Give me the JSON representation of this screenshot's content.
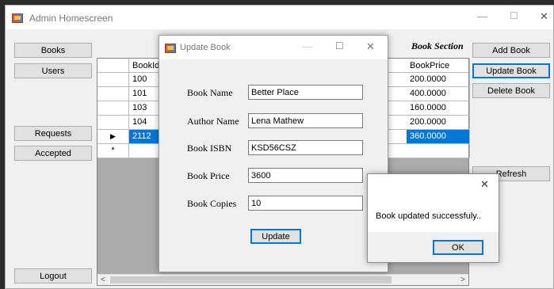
{
  "window": {
    "title": "Admin Homescreen"
  },
  "nav": {
    "books": "Books",
    "users": "Users",
    "requests": "Requests",
    "accepted": "Accepted",
    "logout": "Logout"
  },
  "actions": {
    "section_title": "Book Section",
    "add_book": "Add Book",
    "update_book": "Update Book",
    "delete_book": "Delete Book",
    "refresh": "Refresh"
  },
  "grid": {
    "columns": [
      "BookId",
      "BookPrice"
    ],
    "rows": [
      {
        "id": "100",
        "price": "200.0000"
      },
      {
        "id": "101",
        "price": "400.0000"
      },
      {
        "id": "103",
        "price": "160.0000"
      },
      {
        "id": "104",
        "price": "200.0000"
      },
      {
        "id": "2112",
        "price": "360.0000"
      }
    ],
    "current_row_marker": "▶",
    "new_row_marker": "*"
  },
  "dialog": {
    "title": "Update Book",
    "fields": [
      {
        "label": "Book Name",
        "value": "Better Place"
      },
      {
        "label": "Author Name",
        "value": "Lena Mathew"
      },
      {
        "label": "Book ISBN",
        "value": "KSD56CSZ"
      },
      {
        "label": "Book Price",
        "value": "3600"
      },
      {
        "label": "Book Copies",
        "value": "10"
      }
    ],
    "update_button": "Update"
  },
  "message": {
    "text": "Book updated successfuly..",
    "ok_button": "OK"
  },
  "glyphs": {
    "minimize": "—",
    "maximize": "☐",
    "close": "✕",
    "scroll_left": "<",
    "scroll_right": ">"
  }
}
